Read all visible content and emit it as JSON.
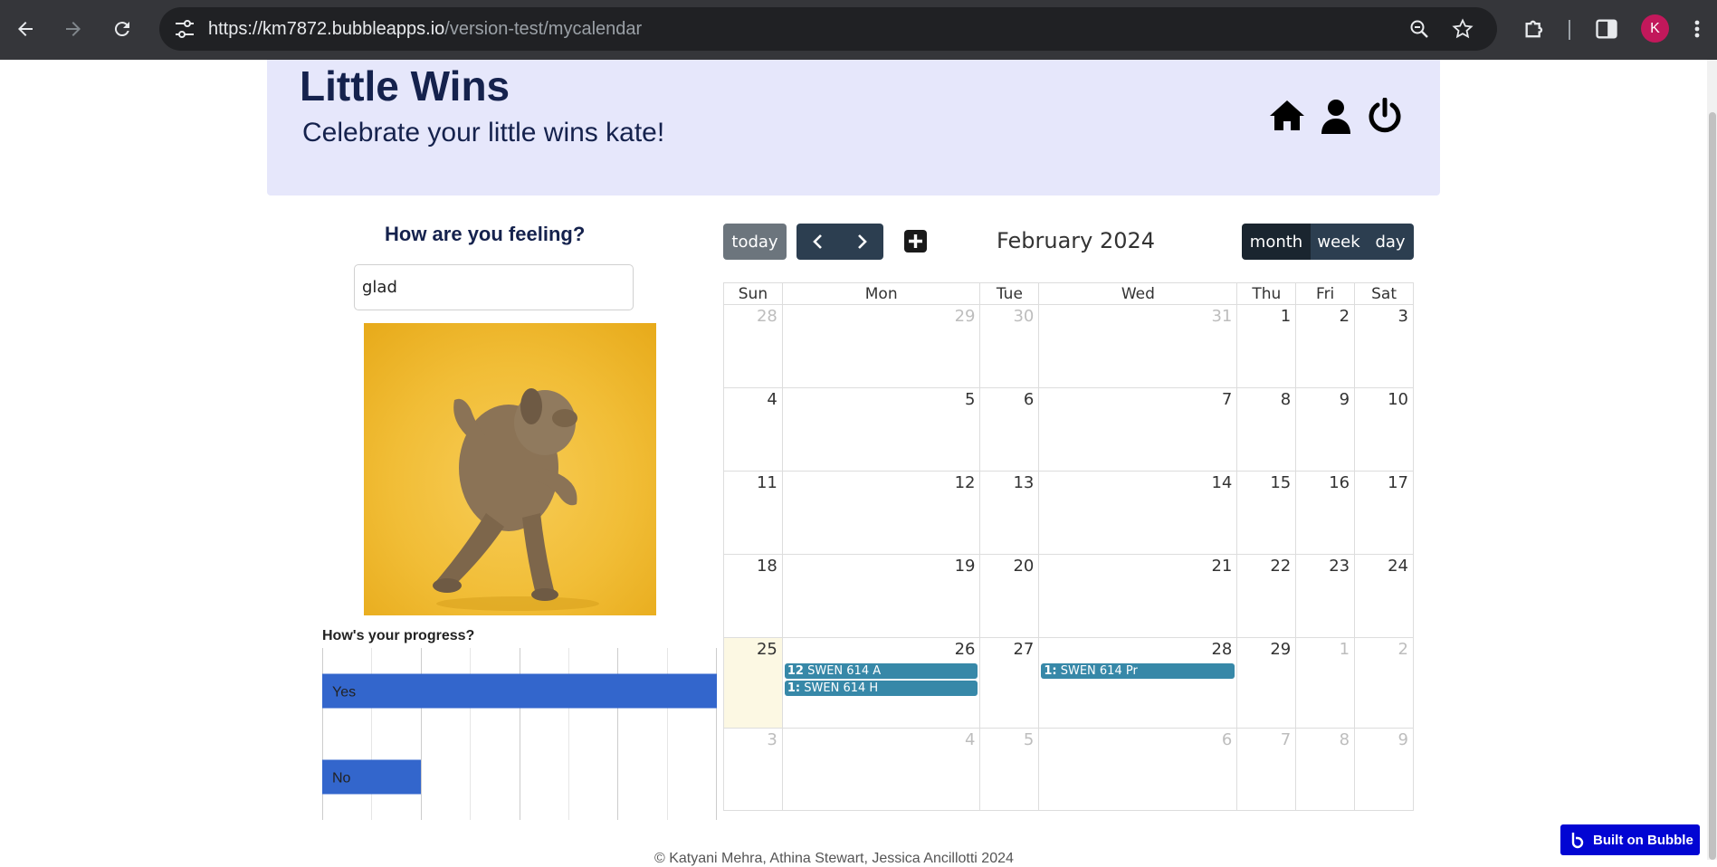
{
  "browser": {
    "url_host": "https://km7872.bubbleapps.io",
    "url_path": "/version-test/mycalendar",
    "profile_initial": "K"
  },
  "header": {
    "title": "Little Wins",
    "subtitle": "Celebrate your little wins kate!",
    "icons": [
      "home-icon",
      "user-icon",
      "power-icon"
    ]
  },
  "feeling": {
    "label": "How are you feeling?",
    "value": "glad"
  },
  "progress": {
    "label": "How's your progress?"
  },
  "chart_data": {
    "type": "bar",
    "orientation": "horizontal",
    "categories": [
      "Yes",
      "No"
    ],
    "values": [
      4,
      1
    ],
    "xlim": [
      0,
      4
    ],
    "grid": true,
    "color": "#3366cc"
  },
  "calendar": {
    "today_label": "today",
    "title": "February 2024",
    "views": [
      {
        "label": "month",
        "active": true
      },
      {
        "label": "week",
        "active": false
      },
      {
        "label": "day",
        "active": false
      }
    ],
    "weekdays": [
      "Sun",
      "Mon",
      "Tue",
      "Wed",
      "Thu",
      "Fri",
      "Sat"
    ],
    "weeks": [
      [
        {
          "d": "28",
          "o": true
        },
        {
          "d": "29",
          "o": true
        },
        {
          "d": "30",
          "o": true
        },
        {
          "d": "31",
          "o": true
        },
        {
          "d": "1"
        },
        {
          "d": "2"
        },
        {
          "d": "3"
        }
      ],
      [
        {
          "d": "4"
        },
        {
          "d": "5"
        },
        {
          "d": "6"
        },
        {
          "d": "7"
        },
        {
          "d": "8"
        },
        {
          "d": "9"
        },
        {
          "d": "10"
        }
      ],
      [
        {
          "d": "11"
        },
        {
          "d": "12"
        },
        {
          "d": "13"
        },
        {
          "d": "14"
        },
        {
          "d": "15"
        },
        {
          "d": "16"
        },
        {
          "d": "17"
        }
      ],
      [
        {
          "d": "18"
        },
        {
          "d": "19"
        },
        {
          "d": "20"
        },
        {
          "d": "21"
        },
        {
          "d": "22"
        },
        {
          "d": "23"
        },
        {
          "d": "24"
        }
      ],
      [
        {
          "d": "25",
          "today": true
        },
        {
          "d": "26",
          "events": [
            {
              "time": "12",
              "title": "SWEN 614 A"
            },
            {
              "time": "1:",
              "title": "SWEN 614 H"
            }
          ]
        },
        {
          "d": "27"
        },
        {
          "d": "28",
          "events": [
            {
              "time": "1:",
              "title": "SWEN 614 Pr"
            }
          ]
        },
        {
          "d": "29"
        },
        {
          "d": "1",
          "o": true
        },
        {
          "d": "2",
          "o": true
        }
      ],
      [
        {
          "d": "3",
          "o": true
        },
        {
          "d": "4",
          "o": true
        },
        {
          "d": "5",
          "o": true
        },
        {
          "d": "6",
          "o": true
        },
        {
          "d": "7",
          "o": true
        },
        {
          "d": "8",
          "o": true
        },
        {
          "d": "9",
          "o": true
        }
      ]
    ]
  },
  "footer": {
    "text": "© Katyani Mehra, Athina Stewart, Jessica Ancillotti 2024",
    "badge": "Built on Bubble"
  },
  "colors": {
    "header_bg": "#e6e7fb",
    "title": "#15224d",
    "event": "#3788a8",
    "today_cell": "#fcf8e3",
    "badge": "#0205d3"
  }
}
